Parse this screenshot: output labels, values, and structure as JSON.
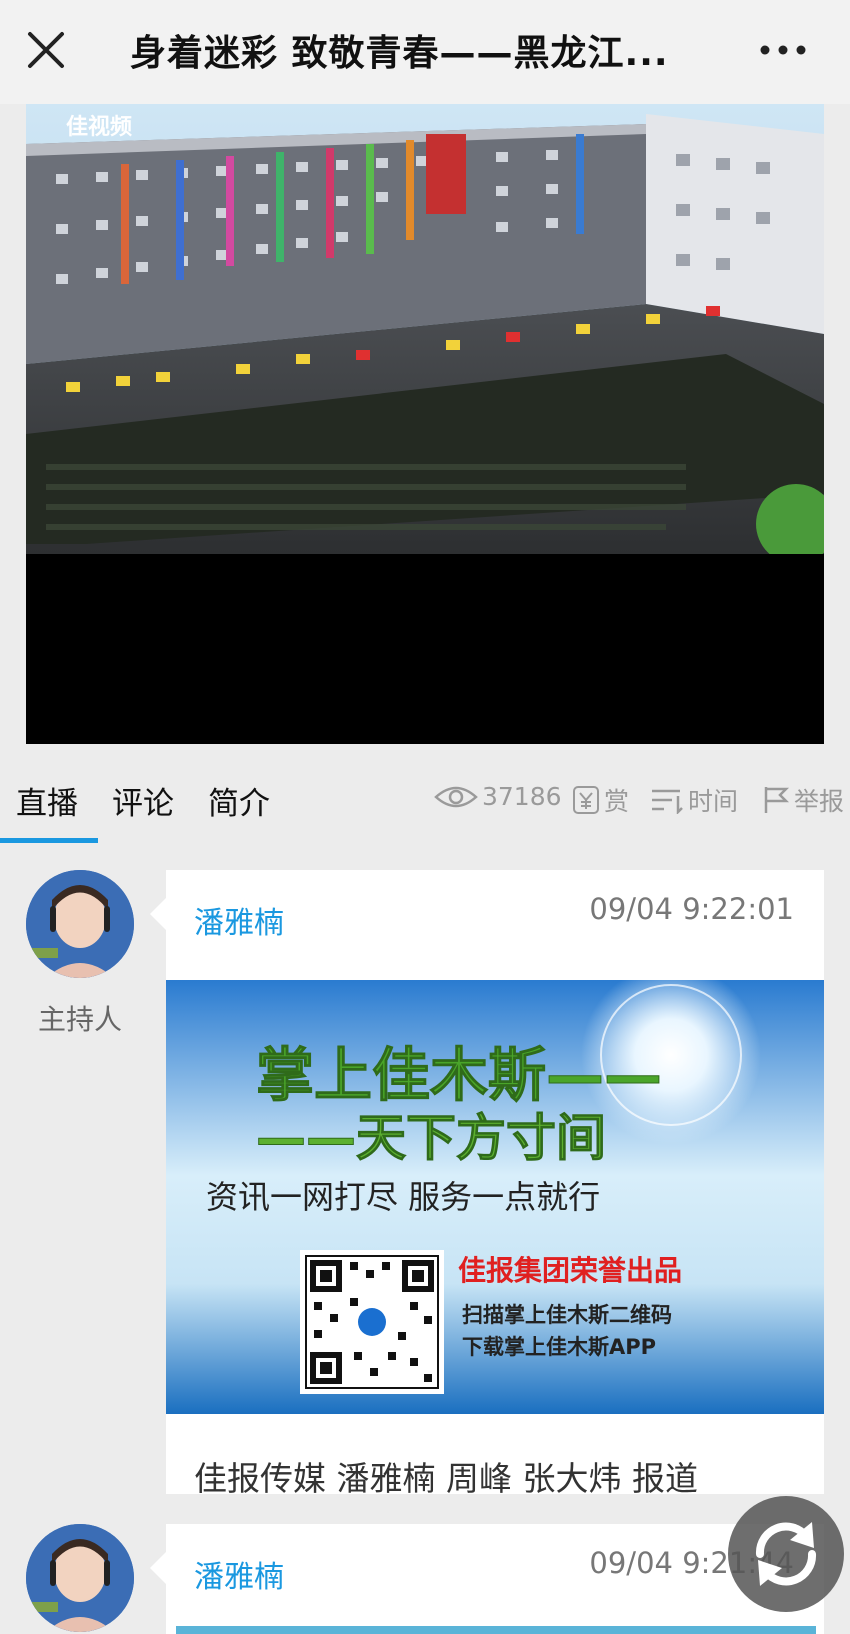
{
  "header": {
    "title": "身着迷彩 致敬青春——黑龙江...",
    "close_icon": "close-icon",
    "more_icon": "more-icon"
  },
  "video": {
    "watermark": "佳视频"
  },
  "tabs": [
    {
      "label": "直播",
      "active": true
    },
    {
      "label": "评论",
      "active": false
    },
    {
      "label": "简介",
      "active": false
    }
  ],
  "stats": {
    "views": "37186",
    "reward_label": "赏",
    "sort_label": "时间",
    "report_label": "举报"
  },
  "posts": [
    {
      "author": "潘雅楠",
      "role": "主持人",
      "time": "09/04 9:22:01",
      "image": {
        "headline1": "掌上佳木斯——",
        "headline2": "——天下方寸间",
        "slogan": "资讯一网打尽  服务一点就行",
        "brand": "佳报集团荣誉出品",
        "line1": "扫描掌上佳木斯二维码",
        "line2": "下载掌上佳木斯APP"
      },
      "caption": "佳报传媒 潘雅楠 周峰 张大炜 报道"
    },
    {
      "author": "潘雅楠",
      "time": "09/04 9:21:44"
    }
  ],
  "colors": {
    "accent": "#1a98e0",
    "background": "#ececec"
  }
}
